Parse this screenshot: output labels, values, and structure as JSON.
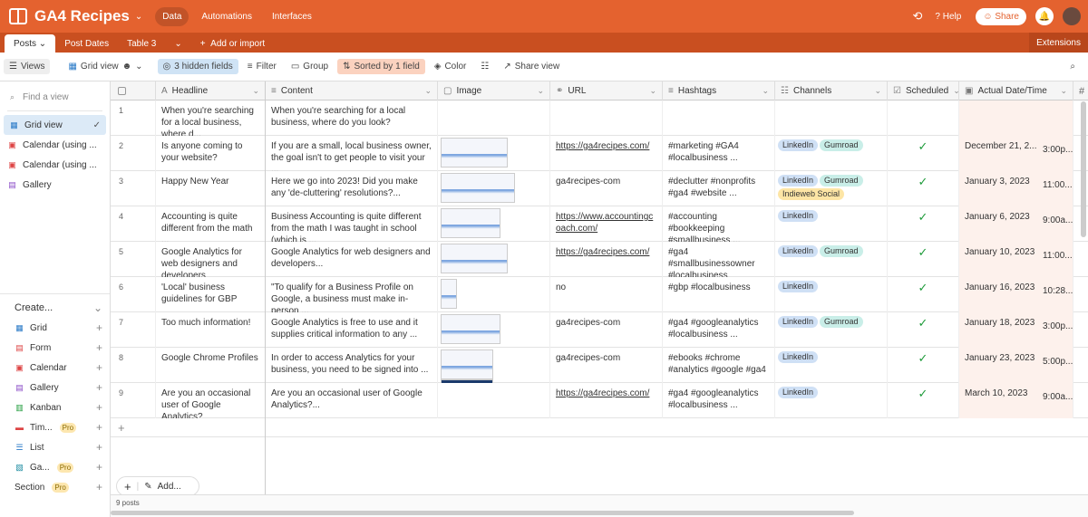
{
  "app": {
    "title": "GA4 Recipes",
    "nav": [
      "Data",
      "Automations",
      "Interfaces"
    ],
    "help": "Help",
    "share": "Share"
  },
  "tables": [
    "Posts",
    "Post Dates",
    "Table 3"
  ],
  "add_import": "Add or import",
  "extensions": "Extensions",
  "toolbar": {
    "views": "Views",
    "grid_view": "Grid view",
    "hidden_fields": "3 hidden fields",
    "filter": "Filter",
    "group": "Group",
    "sorted": "Sorted by 1 field",
    "color": "Color",
    "share_view": "Share view"
  },
  "sidebar": {
    "find_placeholder": "Find a view",
    "views": [
      "Grid view",
      "Calendar (using ...",
      "Calendar (using ...",
      "Gallery"
    ],
    "create_label": "Create...",
    "create_items": [
      {
        "label": "Grid",
        "pro": ""
      },
      {
        "label": "Form",
        "pro": ""
      },
      {
        "label": "Calendar",
        "pro": ""
      },
      {
        "label": "Gallery",
        "pro": ""
      },
      {
        "label": "Kanban",
        "pro": ""
      },
      {
        "label": "Tim...",
        "pro": "Pro"
      },
      {
        "label": "List",
        "pro": ""
      },
      {
        "label": "Ga...",
        "pro": "Pro"
      },
      {
        "label": "Section",
        "pro": "Pro"
      }
    ]
  },
  "columns": [
    "Headline",
    "Content",
    "Image",
    "URL",
    "Hashtags",
    "Channels",
    "Scheduled",
    "Actual Date/Time"
  ],
  "rows": [
    {
      "n": "1",
      "headline": "When you're searching for a local business, where d...",
      "content": "When you're searching for a local business, where do you look?",
      "images": 0,
      "url": "",
      "url_link": false,
      "hashtags": "",
      "channels": [],
      "scheduled": false,
      "date": "",
      "time": ""
    },
    {
      "n": "2",
      "headline": "Is anyone coming to your website?",
      "content": "If you are a small, local business owner, the goal isn't to get people to visit your ...",
      "images": 1,
      "url": "https://ga4recipes.com/",
      "url_link": true,
      "hashtags": "#marketing #GA4 #localbusiness ...",
      "channels": [
        "LinkedIn",
        "Gumroad"
      ],
      "scheduled": true,
      "date": "December 21, 2...",
      "time": "3:00p..."
    },
    {
      "n": "3",
      "headline": "Happy New Year",
      "content": "Here we go into 2023! Did you make any 'de-cluttering' resolutions?...",
      "images": 1,
      "url": "ga4recipes-com",
      "url_link": false,
      "hashtags": "#declutter #nonprofits #ga4 #website ...",
      "channels": [
        "LinkedIn",
        "Gumroad",
        "Indieweb Social"
      ],
      "scheduled": true,
      "date": "January 3, 2023",
      "time": "11:00..."
    },
    {
      "n": "4",
      "headline": "Accounting is quite different from the math ...",
      "content": "Business Accounting is quite different from the math I was taught in school (which is ...",
      "images": 1,
      "url": "https://www.accountingcoach.com/",
      "url_link": true,
      "hashtags": "#accounting #bookkeeping #smallbusiness ...",
      "channels": [
        "LinkedIn"
      ],
      "scheduled": true,
      "date": "January 6, 2023",
      "time": "9:00a..."
    },
    {
      "n": "5",
      "headline": "Google Analytics for web designers and developers",
      "content": "Google Analytics for web designers and developers...",
      "images": 1,
      "url": "https://ga4recipes.com/",
      "url_link": true,
      "hashtags": "#ga4 #smallbusinessowner #localbusiness #analytics...",
      "channels": [
        "LinkedIn",
        "Gumroad"
      ],
      "scheduled": true,
      "date": "January 10, 2023",
      "time": "11:00..."
    },
    {
      "n": "6",
      "headline": "'Local' business guidelines for GBP",
      "content": "\"To qualify for a Business Profile on Google, a business must make in-person ...",
      "images": 1,
      "url": "no",
      "url_link": false,
      "hashtags": "#gbp #localbusiness",
      "channels": [
        "LinkedIn"
      ],
      "scheduled": true,
      "date": "January 16, 2023",
      "time": "10:28..."
    },
    {
      "n": "7",
      "headline": "Too much information!",
      "content": "Google Analytics is free to use and it supplies critical information to any ...",
      "images": 1,
      "url": "ga4recipes-com",
      "url_link": false,
      "hashtags": "#ga4 #googleanalytics #localbusiness ...",
      "channels": [
        "LinkedIn",
        "Gumroad"
      ],
      "scheduled": true,
      "date": "January 18, 2023",
      "time": "3:00p..."
    },
    {
      "n": "8",
      "headline": "Google Chrome Profiles",
      "content": "In order to access Analytics for your business, you need to be signed into ...",
      "images": 2,
      "url": "ga4recipes-com",
      "url_link": false,
      "hashtags": "#ebooks #chrome #analytics #google #ga4",
      "channels": [
        "LinkedIn"
      ],
      "scheduled": true,
      "date": "January 23, 2023",
      "time": "5:00p..."
    },
    {
      "n": "9",
      "headline": "Are you an occasional user of Google Analytics?",
      "content": "Are you an occasional user of Google Analytics?...",
      "images": 0,
      "url": "https://ga4recipes.com/",
      "url_link": true,
      "hashtags": "#ga4 #googleanalytics #localbusiness ...",
      "channels": [
        "LinkedIn"
      ],
      "scheduled": true,
      "date": "March 10, 2023",
      "time": "9:00a..."
    }
  ],
  "footer": {
    "count": "9 posts",
    "add": "Add..."
  },
  "colors": {
    "brand": "#e4622f",
    "tab_bar": "#c94f20",
    "linkedin_tag": "#cfe0f5",
    "gumroad_tag": "#c9eee8",
    "indieweb_tag": "#fde5a5",
    "check": "#1e9b3a"
  }
}
